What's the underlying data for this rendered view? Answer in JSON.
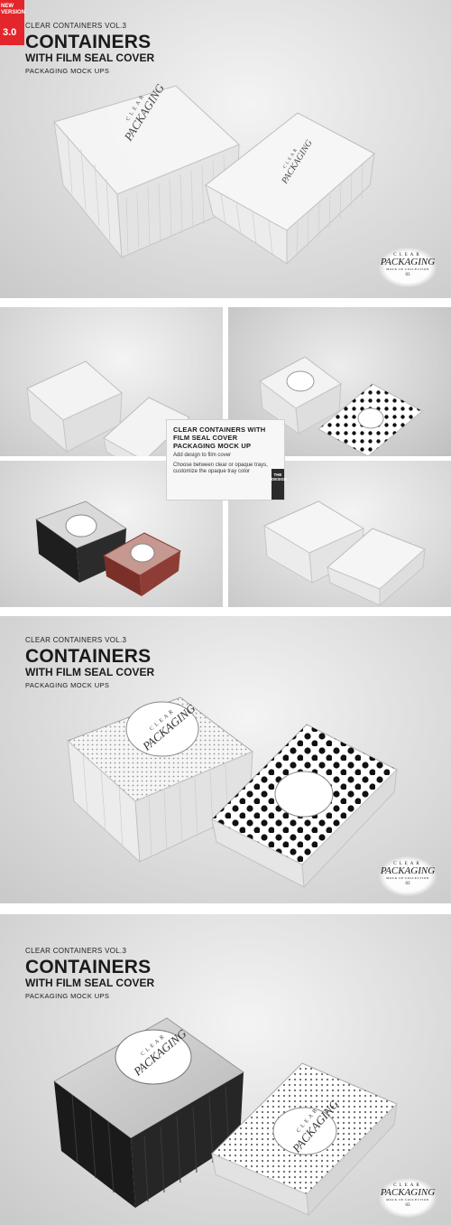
{
  "badge": {
    "line1": "NEW VERSION",
    "version": "3.0"
  },
  "header": {
    "series": "CLEAR CONTAINERS VOL.3",
    "title": "CONTAINERS",
    "subtitle": "WITH FILM SEAL COVER",
    "tagline": "PACKAGING MOCK UPS"
  },
  "stamp": {
    "word1": "CLEAR",
    "word2": "PACKAGING",
    "word3": "MOCK UP COLLECTION",
    "number": "03"
  },
  "lid_label": {
    "word1": "CLEAR",
    "word2": "PACKAGING"
  },
  "info_box": {
    "title": "CLEAR CONTAINERS WITH FILM SEAL COVER PACKAGING  MOCK UP",
    "line1": "Add design to film cover",
    "line2": "Choose between clear or opaque trays, customize the opaque tray color"
  },
  "brand_tab": "THE DESIGN",
  "colors": {
    "badge": "#e3262b",
    "tray_black": "#1e1e1e",
    "tray_copper": "#8e3d36",
    "dots": "#111111"
  }
}
